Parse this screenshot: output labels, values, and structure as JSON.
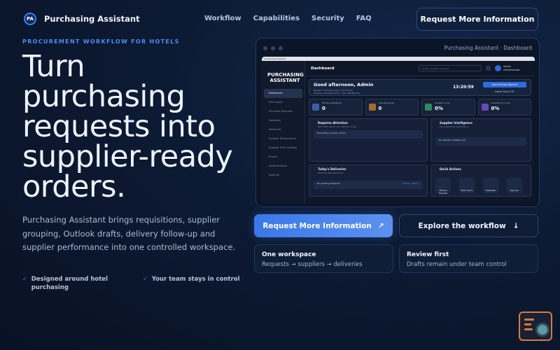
{
  "nav": {
    "logo_text": "PA",
    "brand": "Purchasing Assistant",
    "links": [
      "Workflow",
      "Capabilities",
      "Security",
      "FAQ"
    ],
    "cta": "Request More Information"
  },
  "hero": {
    "eyebrow": "PROCUREMENT WORKFLOW FOR HOTELS",
    "headline": "Turn purchasing requests into supplier-ready orders.",
    "description": "Purchasing Assistant brings requisitions, supplier grouping, Outlook drafts, delivery follow-up and supplier performance into one controlled workspace.",
    "points": [
      "Designed around hotel purchasing",
      "Your team stays in control"
    ]
  },
  "dashboard": {
    "window_title": "Purchasing Assistant · Dashboard",
    "browser_tab": "Purchasing Assistant",
    "sidebar_logo": "PURCHASING ASSISTANT",
    "sidebar_items": [
      "Dashboard",
      "PDF Import",
      "Purchase Requests",
      "Database",
      "Deliveries",
      "Supplier Performance",
      "Supplier Price Catalog",
      "Emails",
      "Administration",
      "Settings"
    ],
    "page_title": "Dashboard",
    "search_placeholder": "Search requests, suppliers",
    "user_name": "Admin",
    "user_role": "Administrator",
    "greeting": "Good afternoon, Admin",
    "greeting_sub": "Ready to manage today's purchasing",
    "greeting_date": "Tuesday 12 August 2025 · Type: Refrigerator",
    "time": "13:20:59",
    "btn_new": "New Purchase Request",
    "btn_import": "Import Items CSV",
    "stats": [
      {
        "label": "Pending Refreshes",
        "value": "0",
        "color": "#3a5fa8"
      },
      {
        "label": "Late Deliveries",
        "value": "0",
        "color": "#a86a2e"
      },
      {
        "label": "Supplier Score",
        "value": "0%",
        "color": "#2e8a5a"
      },
      {
        "label": "Quantity Accuracy",
        "value": "0%",
        "color": "#6a47b3"
      }
    ],
    "attention_title": "Requires Attention",
    "attention_sub": "Items that require your attention today",
    "attention_row": "Everything is under control",
    "intel_title": "Supplier Intelligence",
    "intel_sub": "Top suppliers by performance",
    "intel_row": "No relevant suppliers yet",
    "deliveries_title": "Today's Deliveries",
    "deliveries_sub": "Expected deliveries today",
    "deliveries_row": "No pending deliveries",
    "deliveries_link": "Delivery Status",
    "quick_title": "Quick Actions",
    "quick_actions": [
      "Manual Request",
      "PDF Import",
      "Database",
      "Reports"
    ]
  },
  "ctas": {
    "primary": "Request More Information",
    "primary_icon": "↗",
    "secondary": "Explore the workflow",
    "secondary_icon": "↓"
  },
  "features": [
    {
      "title": "One workspace",
      "desc": "Requests → suppliers → deliveries"
    },
    {
      "title": "Review first",
      "desc": "Drafts remain under team control"
    }
  ],
  "help_widget": "help-chat-icon"
}
